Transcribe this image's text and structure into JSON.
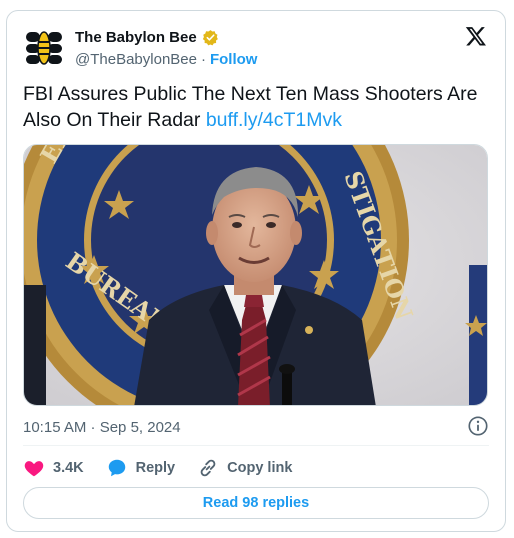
{
  "account": {
    "name": "The Babylon Bee",
    "handle": "@TheBabylonBee",
    "separator": "·",
    "follow_label": "Follow",
    "verified_badge_color": "#e2b719"
  },
  "tweet": {
    "text": "FBI Assures Public The Next Ten Mass Shooters Are Also On Their Radar ",
    "link": "buff.ly/4cT1Mvk",
    "media_icon": "press-conference-photo",
    "timestamp": "10:15 AM · Sep 5, 2024"
  },
  "actions": {
    "like_count": "3.4K",
    "reply_label": "Reply",
    "copy_label": "Copy link"
  },
  "read_replies_label": "Read 98 replies",
  "colors": {
    "accent": "#1d9bf0",
    "like": "#f91880",
    "text_secondary": "#536471",
    "border": "#cfd9de"
  }
}
